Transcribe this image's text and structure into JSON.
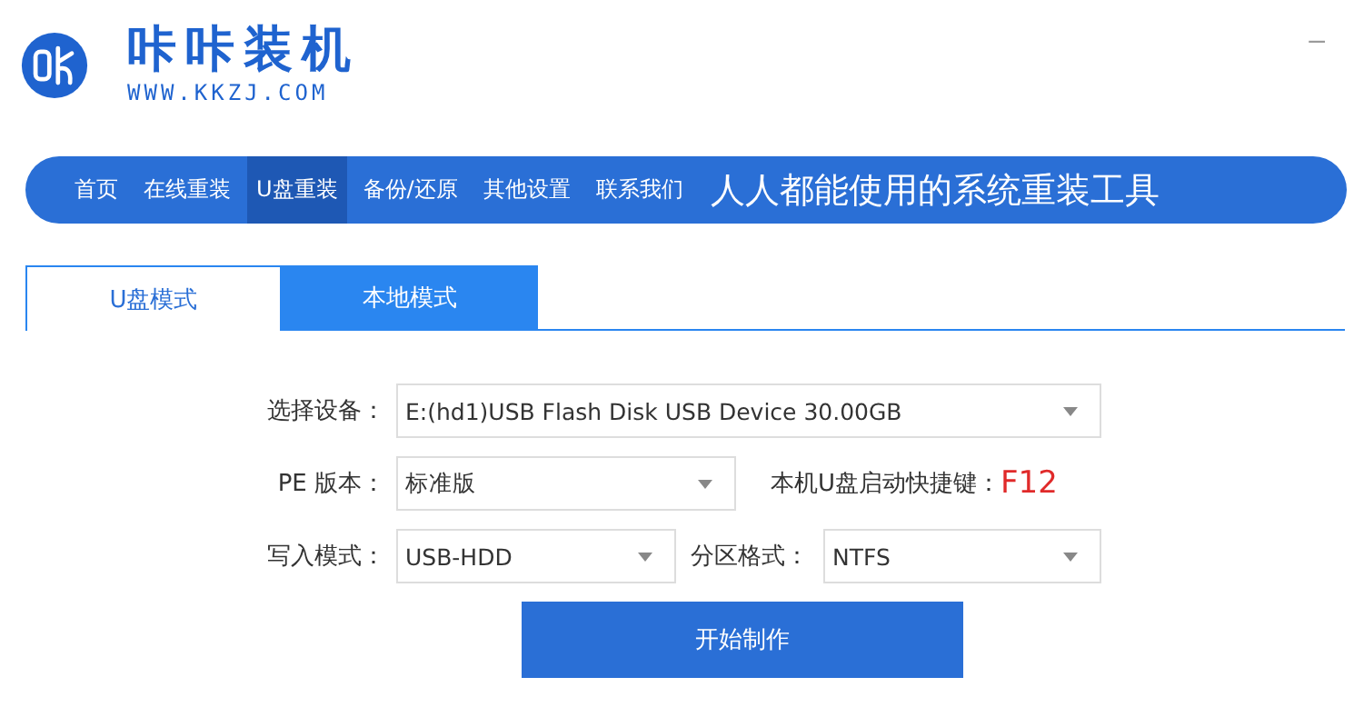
{
  "app": {
    "title": "咔咔装机",
    "url": "WWW.KKZJ.COM",
    "minimize": "–"
  },
  "nav": {
    "items": [
      {
        "label": "首页",
        "selected": false
      },
      {
        "label": "在线重装",
        "selected": false
      },
      {
        "label": "U盘重装",
        "selected": true
      },
      {
        "label": "备份/还原",
        "selected": false
      },
      {
        "label": "其他设置",
        "selected": false
      },
      {
        "label": "联系我们",
        "selected": false
      }
    ],
    "slogan": "人人都能使用的系统重装工具"
  },
  "tabs": [
    {
      "label": "U盘模式",
      "selected": true
    },
    {
      "label": "本地模式",
      "selected": false
    }
  ],
  "form": {
    "device": {
      "label": "选择设备：",
      "value": "E:(hd1)USB Flash Disk USB Device 30.00GB"
    },
    "pe": {
      "label": "PE 版本：",
      "value": "标准版"
    },
    "hotkey": {
      "label": "本机U盘启动快捷键：",
      "key": "F12"
    },
    "write_mode": {
      "label": "写入模式：",
      "value": "USB-HDD"
    },
    "partition": {
      "label": "分区格式：",
      "value": "NTFS"
    }
  },
  "start_button": "开始制作"
}
